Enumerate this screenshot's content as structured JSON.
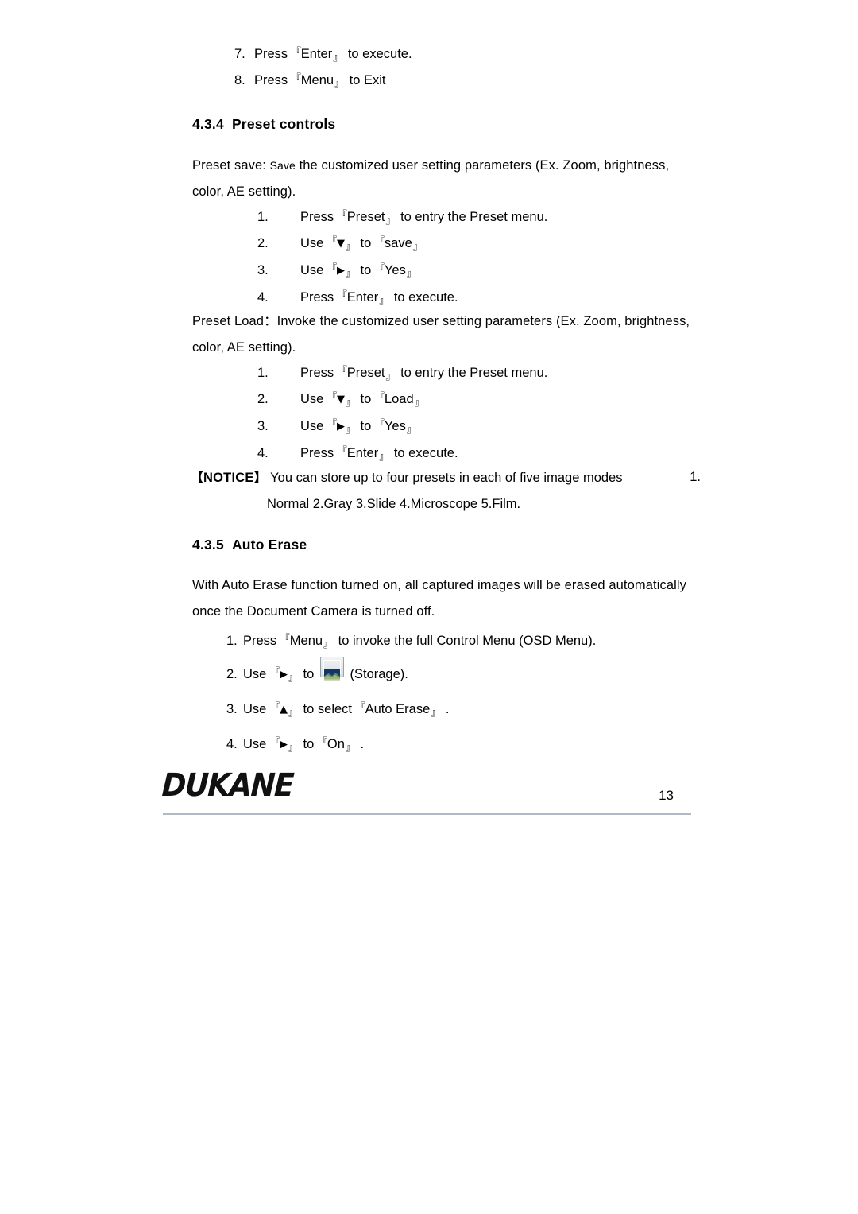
{
  "document": {
    "page_number": "13",
    "brand": "DUKANE"
  },
  "top_list": {
    "items": [
      {
        "num": "7.",
        "pre": "Press ",
        "bracket_open": "『",
        "key": "Enter",
        "bracket_close": "』",
        "post": " to execute."
      },
      {
        "num": "8.",
        "pre": "Press  ",
        "bracket_open": "『",
        "key": "Menu",
        "bracket_close": "』",
        "post": " to Exit"
      }
    ]
  },
  "section_preset": {
    "heading_number": "4.3.4",
    "heading_title": "Preset controls",
    "save_intro": {
      "lead": "Preset save: ",
      "emph": "Save",
      "rest": " the customized user setting parameters (Ex. Zoom, brightness, color, AE setting)."
    },
    "save_steps": [
      {
        "num": "1.",
        "pre": "Press ",
        "b1": "『",
        "k1": "Preset",
        "b2": "』",
        "mid": " to entry the Preset menu."
      },
      {
        "num": "2.",
        "pre": "Use ",
        "b1": "『",
        "k1": "▼",
        "b2": "』",
        "mid": " to ",
        "b3": "『",
        "k2": "save",
        "b4": "』"
      },
      {
        "num": "3.",
        "pre": "Use ",
        "b1": "『",
        "k1": "▶",
        "b2": "』",
        "mid": " to ",
        "b3": "『",
        "k2": "Yes",
        "b4": "』"
      },
      {
        "num": "4.",
        "pre": "Press ",
        "b1": "『",
        "k1": "Enter",
        "b2": "』",
        "mid": " to execute."
      }
    ],
    "load_intro": "Preset Load：Invoke the customized user setting parameters (Ex. Zoom, brightness, color, AE setting).",
    "load_steps": [
      {
        "num": "1.",
        "pre": "Press ",
        "b1": "『",
        "k1": "Preset",
        "b2": "』",
        "mid": " to entry the Preset menu."
      },
      {
        "num": "2.",
        "pre": "Use ",
        "b1": "『",
        "k1": "▼",
        "b2": "』",
        "mid": " to ",
        "b3": "『",
        "k2": "Load",
        "b4": "』"
      },
      {
        "num": "3.",
        "pre": "Use ",
        "b1": "『",
        "k1": "▶",
        "b2": "』",
        "mid": " to  ",
        "b3": "『",
        "k2": "Yes",
        "b4": "』"
      },
      {
        "num": "4.",
        "pre": "Press ",
        "b1": "『",
        "k1": "Enter",
        "b2": "』",
        "mid": " to execute."
      }
    ],
    "notice": {
      "bracket_open": "【",
      "label": "NOTICE",
      "bracket_close": "】",
      "text": " You can store up to four presets in each of five image modes",
      "tail": "1.",
      "line2": "Normal  2.Gray  3.Slide  4.Microscope  5.Film."
    }
  },
  "section_auto_erase": {
    "heading_number": "4.3.5",
    "heading_title": "Auto Erase",
    "intro": "With Auto Erase function turned on, all captured images will be erased automatically once the Document Camera is turned off.",
    "steps": [
      {
        "num": "1.",
        "pre": "Press ",
        "b1": "『",
        "k1": "Menu",
        "b2": "』",
        "mid": " to invoke the full Control Menu (OSD Menu)."
      },
      {
        "num": "2.",
        "pre": "Use ",
        "b1": "『",
        "k1": "▶",
        "b2": "』",
        "mid": " to ",
        "icon": "storage-thumbnail-icon",
        "post": " (Storage)."
      },
      {
        "num": "3.",
        "pre": "Use ",
        "b1": "『",
        "k1": "▲",
        "b2": "』",
        "mid": " to select ",
        "b3": "『",
        "k2": "Auto Erase",
        "b4": "』",
        "post": " ."
      },
      {
        "num": "4.",
        "pre": "Use ",
        "b1": "『",
        "k1": "▶",
        "b2": "』",
        "mid": " to ",
        "b3": "『",
        "k2": "On",
        "b4": "』",
        "post": " ."
      }
    ]
  },
  "colors": {
    "text": "#000000",
    "rule": "#aebbc6",
    "icon_border": "#9aa3ab"
  }
}
